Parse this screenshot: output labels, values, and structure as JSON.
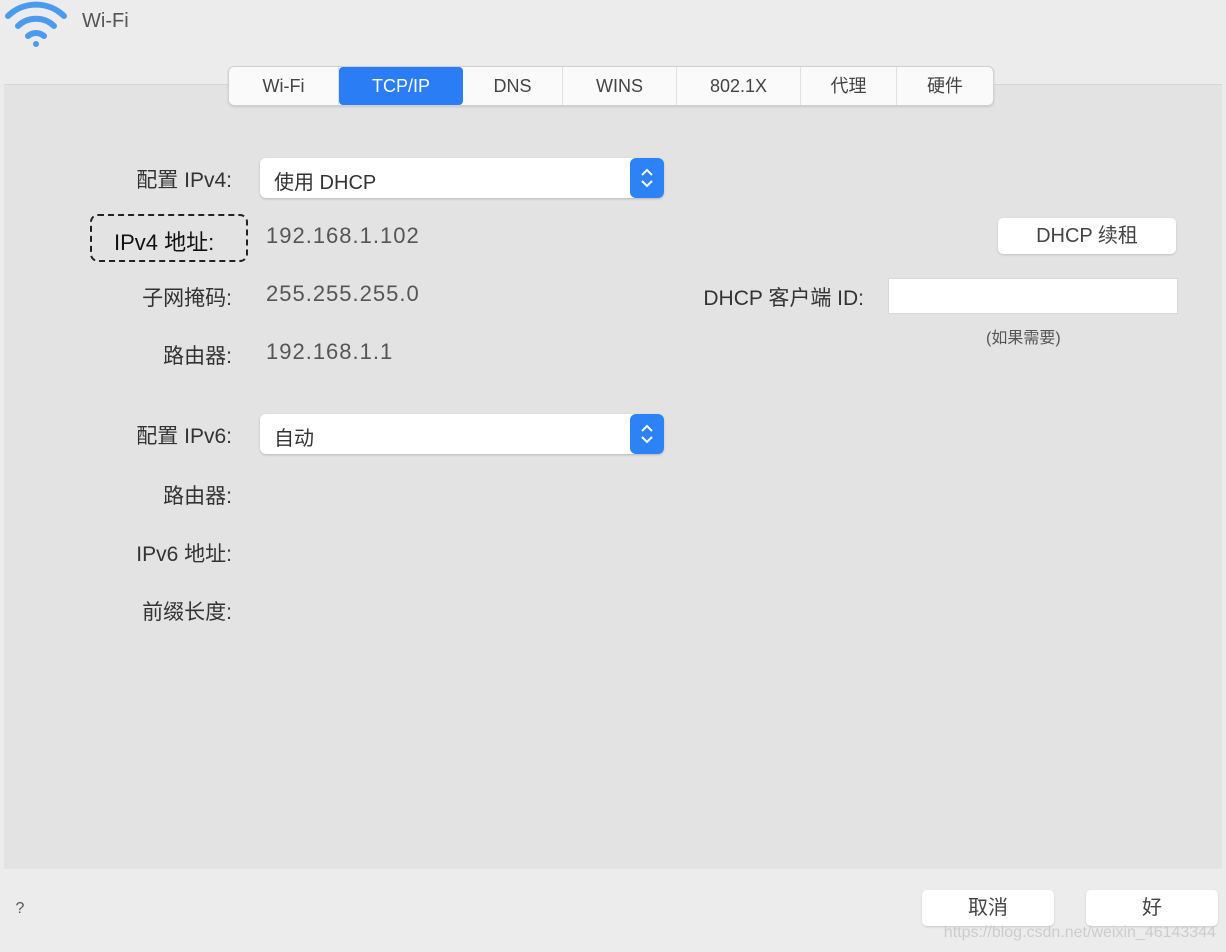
{
  "window": {
    "title": "Wi-Fi"
  },
  "tabs": [
    {
      "label": "Wi-Fi",
      "active": false
    },
    {
      "label": "TCP/IP",
      "active": true
    },
    {
      "label": "DNS",
      "active": false
    },
    {
      "label": "WINS",
      "active": false
    },
    {
      "label": "802.1X",
      "active": false
    },
    {
      "label": "代理",
      "active": false
    },
    {
      "label": "硬件",
      "active": false
    }
  ],
  "ipv4": {
    "config_label": "配置 IPv4:",
    "config_value": "使用 DHCP",
    "address_label": "IPv4 地址:",
    "address_value": "192.168.1.102",
    "subnet_label": "子网掩码:",
    "subnet_value": "255.255.255.0",
    "router_label": "路由器:",
    "router_value": "192.168.1.1"
  },
  "dhcp": {
    "renew_button": "DHCP 续租",
    "client_id_label": "DHCP 客户端 ID:",
    "client_id_value": "",
    "client_id_hint": "(如果需要)"
  },
  "ipv6": {
    "config_label": "配置 IPv6:",
    "config_value": "自动",
    "router_label": "路由器:",
    "address_label": "IPv6 地址:",
    "prefix_label": "前缀长度:"
  },
  "footer": {
    "help": "?",
    "cancel_button": "取消",
    "ok_button": "好",
    "watermark": "https://blog.csdn.net/weixin_46143344"
  },
  "colors": {
    "accent": "#2a7df5",
    "panel": "#e3e3e3",
    "window": "#ececec"
  }
}
